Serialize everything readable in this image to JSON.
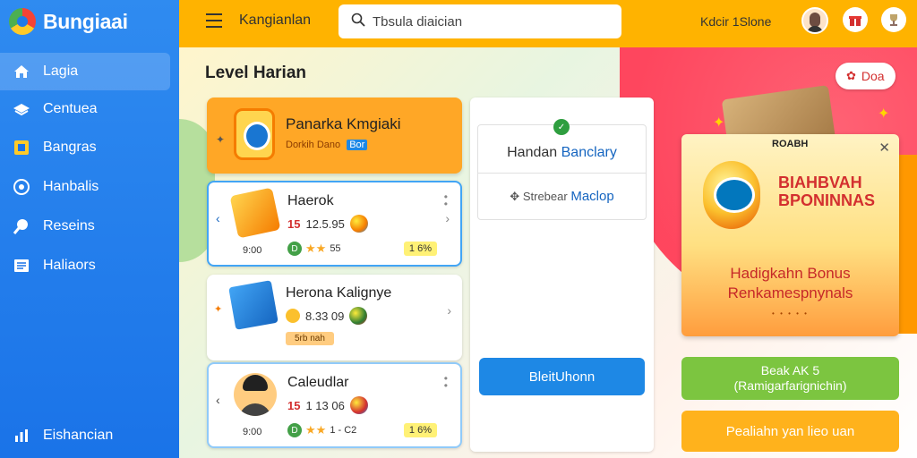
{
  "brand": {
    "name": "Bungiaai"
  },
  "sidebar": {
    "items": [
      {
        "label": "Lagia",
        "icon": "home-icon"
      },
      {
        "label": "Centuea",
        "icon": "layers-icon"
      },
      {
        "label": "Bangras",
        "icon": "tag-icon"
      },
      {
        "label": "Hanbalis",
        "icon": "award-icon"
      },
      {
        "label": "Reseins",
        "icon": "search-icon"
      },
      {
        "label": "Haliaors",
        "icon": "list-icon"
      }
    ],
    "footer_label": "Eishancian"
  },
  "topbar": {
    "title": "Kangianlan",
    "search_value": "Tbsula diaician",
    "status_text": "Kdcir 1Slone"
  },
  "main": {
    "page_title": "Level Harian",
    "badge_label": "Doa",
    "featured": {
      "title": "Panarka Kmgiaki",
      "subtitle": "Dorkih Dano",
      "chip": "Bor"
    },
    "games": [
      {
        "title": "Haerok",
        "meta_num": "15",
        "meta_value": "12.5.95",
        "time": "9:00",
        "chip_left": "D",
        "chip_text": "55",
        "chip_right": "1 6%"
      },
      {
        "title": "Herona Kalignye",
        "meta_value": "8.33 09",
        "chip_left": "5rb nah"
      },
      {
        "title": "Caleudlar",
        "meta_num": "15",
        "meta_value": "1 13 06",
        "time": "9:00",
        "chip_left": "D",
        "chip_text": "1 - C2",
        "chip_right": "1 6%"
      }
    ],
    "middle": {
      "title_a": "Handan",
      "title_b": "Banclary",
      "sub_a": "Strebear",
      "sub_b": "Maclop",
      "button": "BleitUhonn"
    },
    "promo": {
      "label": "ROABH",
      "headline_1": "BIAHBVAH",
      "headline_2": "BPONINNAS",
      "body_1": "Hadigkahn Bonus",
      "body_2": "Renkamespnynals",
      "dots": "• • • • •"
    },
    "green_button": {
      "line1": "Beak AK 5",
      "line2": "(Ramigarfarignichin)"
    },
    "orange_button": "Pealiahn yan lieo uan"
  }
}
